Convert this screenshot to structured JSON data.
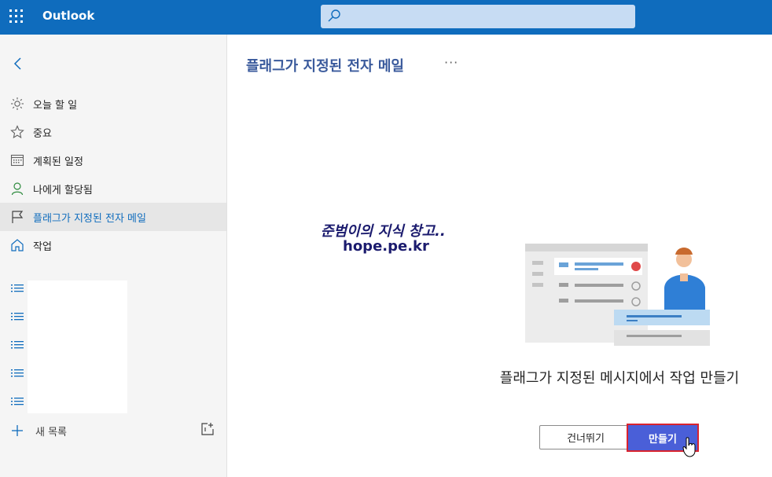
{
  "app": {
    "name": "Outlook"
  },
  "search": {
    "placeholder": "",
    "value": ""
  },
  "sidebar": {
    "items": [
      {
        "label": "오늘 할 일",
        "icon": "sun-icon"
      },
      {
        "label": "중요",
        "icon": "star-icon"
      },
      {
        "label": "계획된 일정",
        "icon": "calendar-icon"
      },
      {
        "label": "나에게 할당됨",
        "icon": "person-icon"
      },
      {
        "label": "플래그가 지정된 전자 메일",
        "icon": "flag-icon",
        "active": true
      },
      {
        "label": "작업",
        "icon": "home-icon"
      }
    ],
    "new_list_label": "새 목록"
  },
  "main": {
    "title": "플래그가 지정된 전자 메일",
    "more_label": "···",
    "empty_message": "플래그가 지정된 메시지에서 작업 만들기",
    "skip_label": "건너뛰기",
    "create_label": "만들기"
  },
  "watermark": {
    "line1": "준범이의 지식 창고..",
    "line2": "hope.pe.kr"
  },
  "colors": {
    "accent": "#0f6cbd",
    "title": "#3a5a9c",
    "create": "#4a5fd8",
    "highlight": "#d9232e"
  }
}
